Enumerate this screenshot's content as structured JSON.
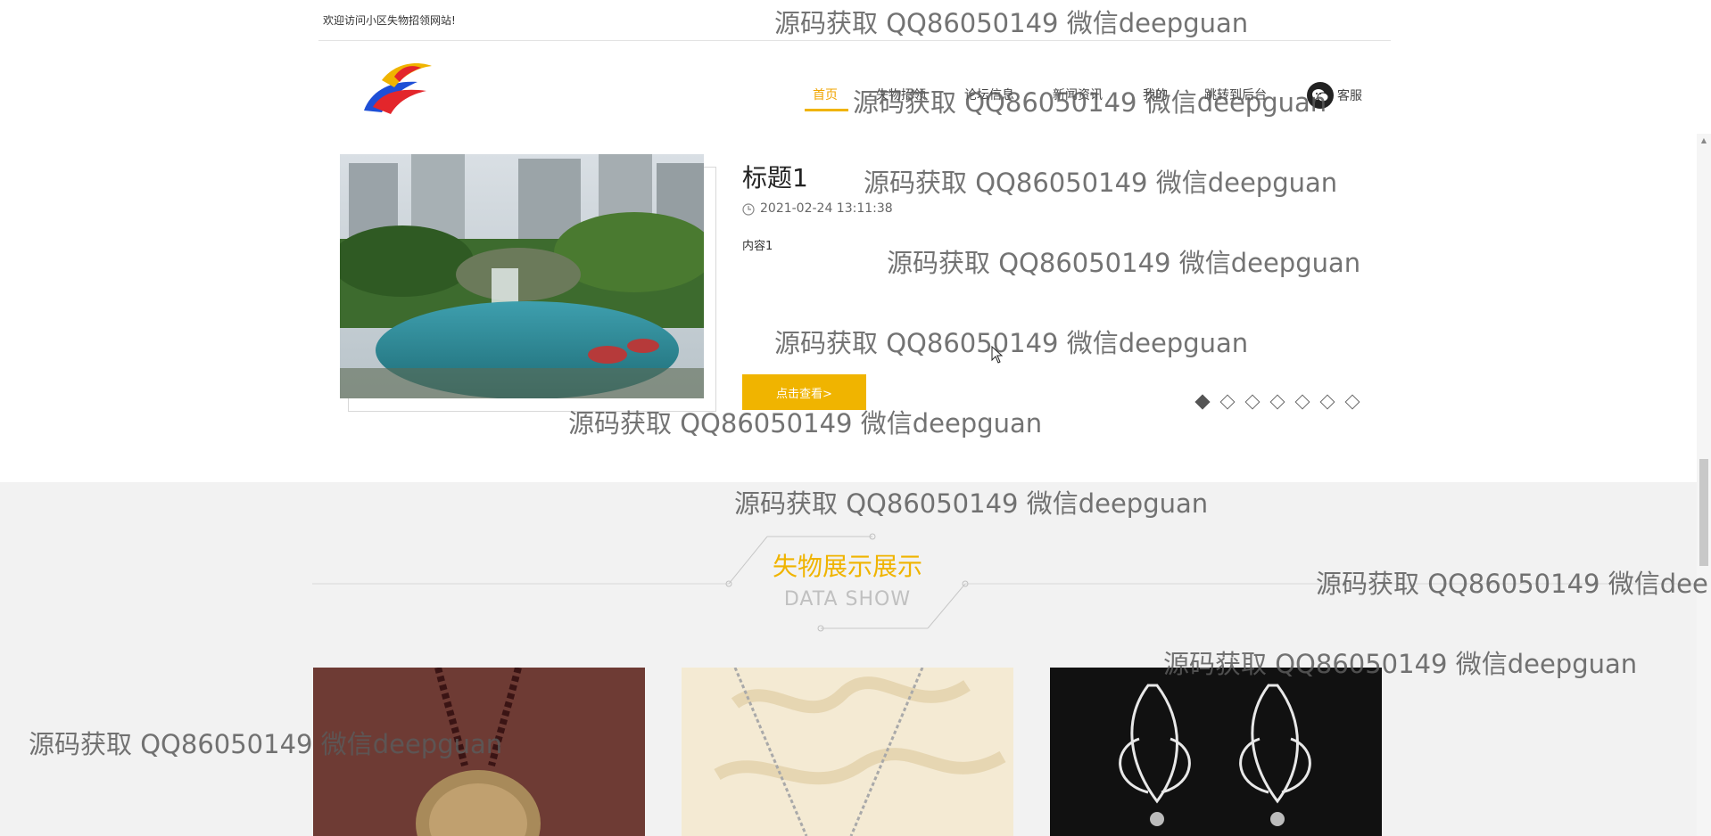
{
  "topbar": {
    "welcome": "欢迎访问小区失物招领网站!"
  },
  "nav": {
    "items": [
      {
        "label": "首页",
        "active": true
      },
      {
        "label": "失物招领"
      },
      {
        "label": "论坛信息"
      },
      {
        "label": "新闻资讯"
      },
      {
        "label": "我的"
      },
      {
        "label": "跳转到后台"
      }
    ],
    "service_label": "客服"
  },
  "news": {
    "title": "标题1",
    "date": "2021-02-24 13:11:38",
    "content": "内容1",
    "button": "点击查看>",
    "dots_total": 7,
    "dots_active_index": 0
  },
  "showcase": {
    "title": "失物展示展示",
    "subtitle": "DATA SHOW"
  },
  "watermark_text": "源码获取 QQ86050149 微信deepguan",
  "watermark_text_cut": "源码获取 QQ86050149 微信dee",
  "colors": {
    "accent": "#f0b400",
    "section_bg": "#f2f2f2"
  }
}
